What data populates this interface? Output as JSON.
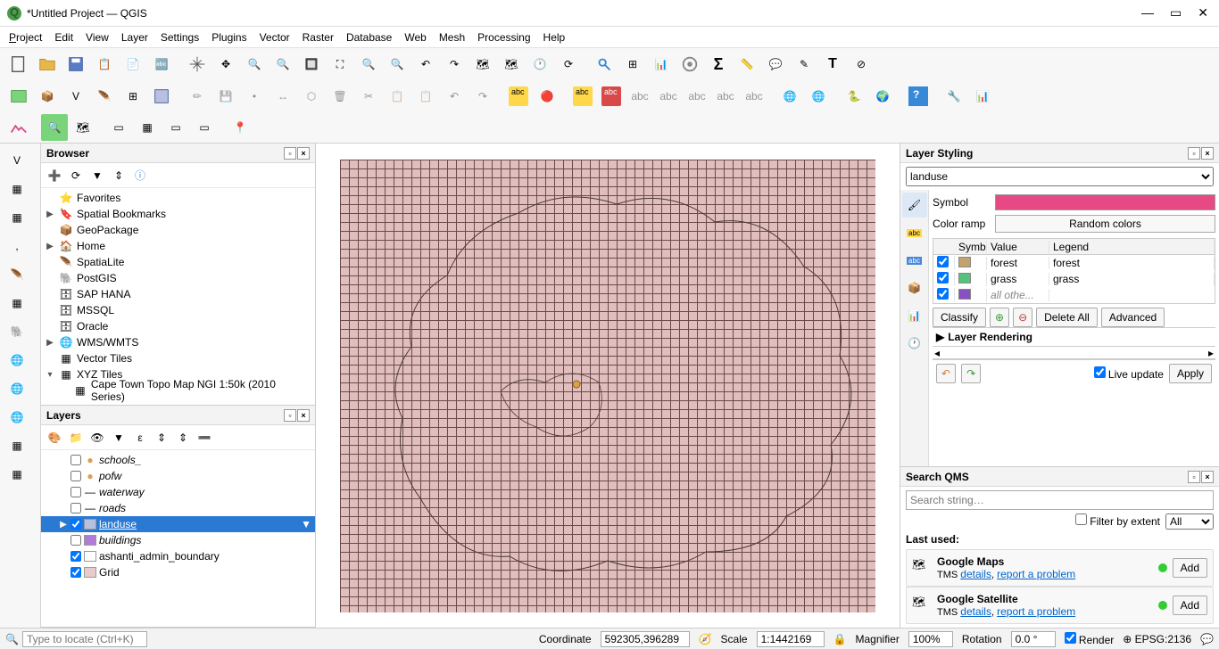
{
  "window": {
    "title": "*Untitled Project — QGIS"
  },
  "menu": [
    "Project",
    "Edit",
    "View",
    "Layer",
    "Settings",
    "Plugins",
    "Vector",
    "Raster",
    "Database",
    "Web",
    "Mesh",
    "Processing",
    "Help"
  ],
  "browser": {
    "title": "Browser",
    "items": [
      {
        "exp": "",
        "icon": "star",
        "label": "Favorites"
      },
      {
        "exp": "▶",
        "icon": "bookmark",
        "label": "Spatial Bookmarks"
      },
      {
        "exp": "",
        "icon": "pkg",
        "label": "GeoPackage"
      },
      {
        "exp": "▶",
        "icon": "home",
        "label": "Home"
      },
      {
        "exp": "",
        "icon": "feather",
        "label": "SpatiaLite"
      },
      {
        "exp": "",
        "icon": "elephant",
        "label": "PostGIS"
      },
      {
        "exp": "",
        "icon": "db",
        "label": "SAP HANA"
      },
      {
        "exp": "",
        "icon": "db",
        "label": "MSSQL"
      },
      {
        "exp": "",
        "icon": "db",
        "label": "Oracle"
      },
      {
        "exp": "▶",
        "icon": "globe",
        "label": "WMS/WMTS"
      },
      {
        "exp": "",
        "icon": "tiles",
        "label": "Vector Tiles"
      },
      {
        "exp": "▾",
        "icon": "tiles",
        "label": "XYZ Tiles"
      },
      {
        "exp": "",
        "icon": "tiles",
        "label": "Cape Town Topo Map NGI 1:50k (2010 Series)",
        "d": 1
      }
    ]
  },
  "layers": {
    "title": "Layers",
    "items": [
      {
        "checked": false,
        "sym": "#d9a24a",
        "label": "schools_",
        "italic": true,
        "symType": "dot"
      },
      {
        "checked": false,
        "sym": "#d9a24a",
        "label": "pofw",
        "italic": true,
        "symType": "dot"
      },
      {
        "checked": false,
        "sym": null,
        "label": "waterway",
        "italic": true,
        "symType": "line"
      },
      {
        "checked": false,
        "sym": null,
        "label": "roads",
        "italic": true,
        "symType": "line"
      },
      {
        "checked": true,
        "sym": "#b7c0e0",
        "label": "landuse",
        "italic": false,
        "sel": true,
        "exp": "▶",
        "under": true
      },
      {
        "checked": false,
        "sym": "#b07cd8",
        "label": "buildings",
        "italic": true
      },
      {
        "checked": true,
        "sym": "#ffffff",
        "label": "ashanti_admin_boundary",
        "italic": false
      },
      {
        "checked": true,
        "sym": "#e8cccc",
        "label": "Grid",
        "italic": false
      }
    ]
  },
  "styling": {
    "title": "Layer Styling",
    "layer": "landuse",
    "symbol_label": "Symbol",
    "symbol_color": "#e64984",
    "ramp_label": "Color ramp",
    "ramp_value": "Random colors",
    "columns": [
      "Symbol",
      "Value",
      "Legend"
    ],
    "rows": [
      {
        "color": "#c4a26e",
        "value": "forest",
        "legend": "forest"
      },
      {
        "color": "#55c37a",
        "value": "grass",
        "legend": "grass"
      },
      {
        "color": "#8a4fc2",
        "value": "all othe...",
        "legend": ""
      }
    ],
    "classify": "Classify",
    "delete_all": "Delete All",
    "advanced": "Advanced",
    "layer_rendering": "Layer Rendering",
    "live_update": "Live update",
    "apply": "Apply"
  },
  "qms": {
    "title": "Search QMS",
    "placeholder": "Search string…",
    "filter_extent": "Filter by extent",
    "all": "All",
    "last_used": "Last used:",
    "items": [
      {
        "name": "Google Maps",
        "sub_prefix": "TMS ",
        "details": "details",
        "sep": ", ",
        "report": "report a problem",
        "add": "Add"
      },
      {
        "name": "Google Satellite",
        "sub_prefix": "TMS ",
        "details": "details",
        "sep": ", ",
        "report": "report a problem",
        "add": "Add"
      }
    ]
  },
  "status": {
    "locator_placeholder": "Type to locate (Ctrl+K)",
    "coord_label": "Coordinate",
    "coord": "592305,396289",
    "scale_label": "Scale",
    "scale": "1:1442169",
    "mag_label": "Magnifier",
    "mag": "100%",
    "rot_label": "Rotation",
    "rot": "0.0 °",
    "render": "Render",
    "epsg": "EPSG:2136"
  }
}
